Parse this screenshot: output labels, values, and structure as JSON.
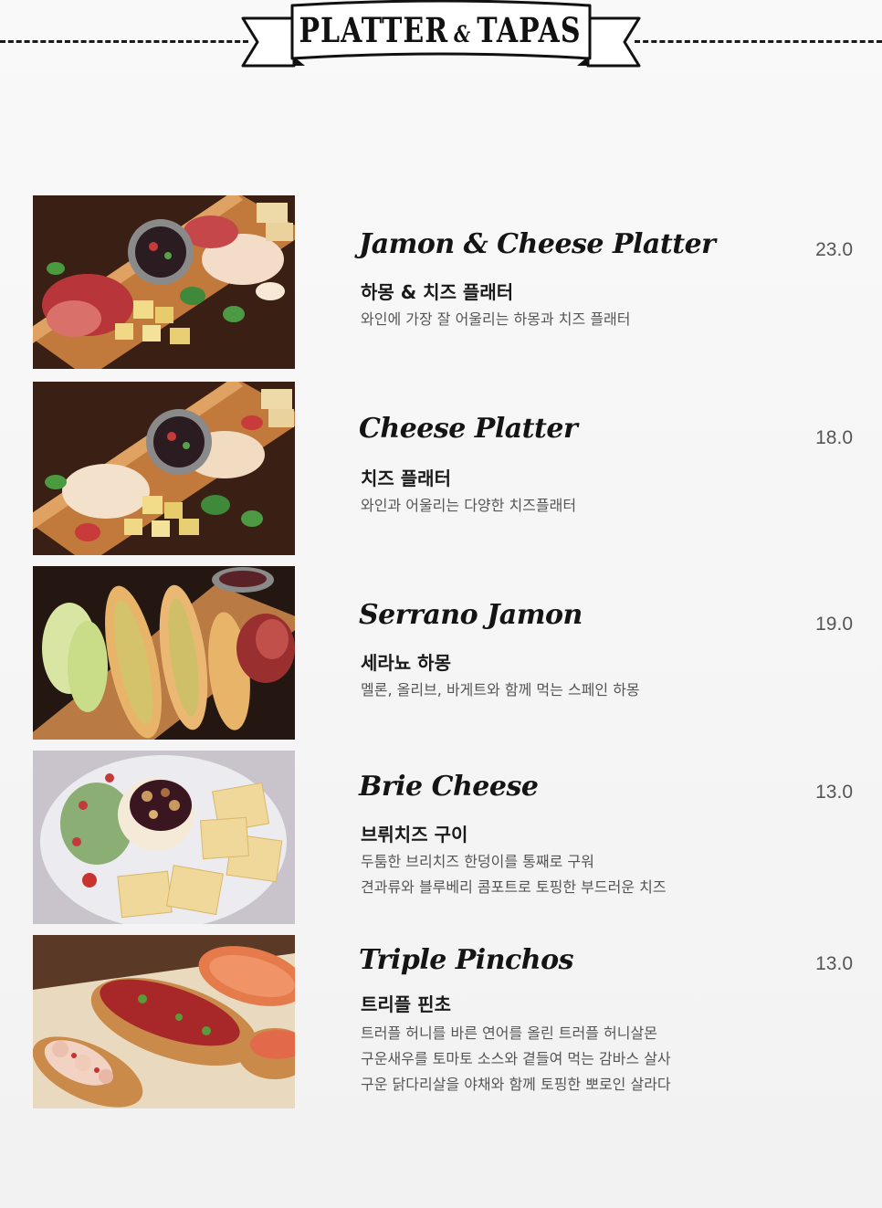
{
  "header": {
    "title_part1": "PLATTER",
    "title_amp": "&",
    "title_part2": "TAPAS"
  },
  "menu": {
    "items": [
      {
        "name_en": "Jamon & Cheese Platter",
        "name_ko": "하몽 & 치즈 플래터",
        "desc": [
          "와인에 가장 잘 어울리는 하몽과 치즈 플래터"
        ],
        "price": "23.0"
      },
      {
        "name_en": "Cheese Platter",
        "name_ko": "치즈 플래터",
        "desc": [
          "와인과 어울리는 다양한 치즈플래터"
        ],
        "price": "18.0"
      },
      {
        "name_en": "Serrano Jamon",
        "name_ko": "세라뇨 하몽",
        "desc": [
          "멜론, 올리브, 바게트와 함께 먹는 스페인 하몽"
        ],
        "price": "19.0"
      },
      {
        "name_en": "Brie Cheese",
        "name_ko": "브뤼치즈 구이",
        "desc": [
          "두툼한 브리치즈 한덩이를 통째로 구워",
          "견과류와 블루베리 콤포트로 토핑한 부드러운 치즈"
        ],
        "price": "13.0"
      },
      {
        "name_en": "Triple Pinchos",
        "name_ko": "트리플 핀초",
        "desc": [
          "트러플 허니를 바른 연어를 올린 트러플 허니살몬",
          "구운새우를 토마토 소스와 곁들여 먹는 감바스 살사",
          "구운 닭다리살을 야채와 함께 토핑한 뽀로인 살라다"
        ],
        "price": "13.0"
      }
    ]
  },
  "colors": {
    "background": "#f6f6f6",
    "text_primary": "#141414",
    "text_secondary": "#555555",
    "wood": "#b8733a",
    "ham": "#b83a3a",
    "cheese": "#f2dc8a",
    "herb": "#3f8a3a"
  },
  "icons": {
    "banner": "ribbon-banner"
  }
}
